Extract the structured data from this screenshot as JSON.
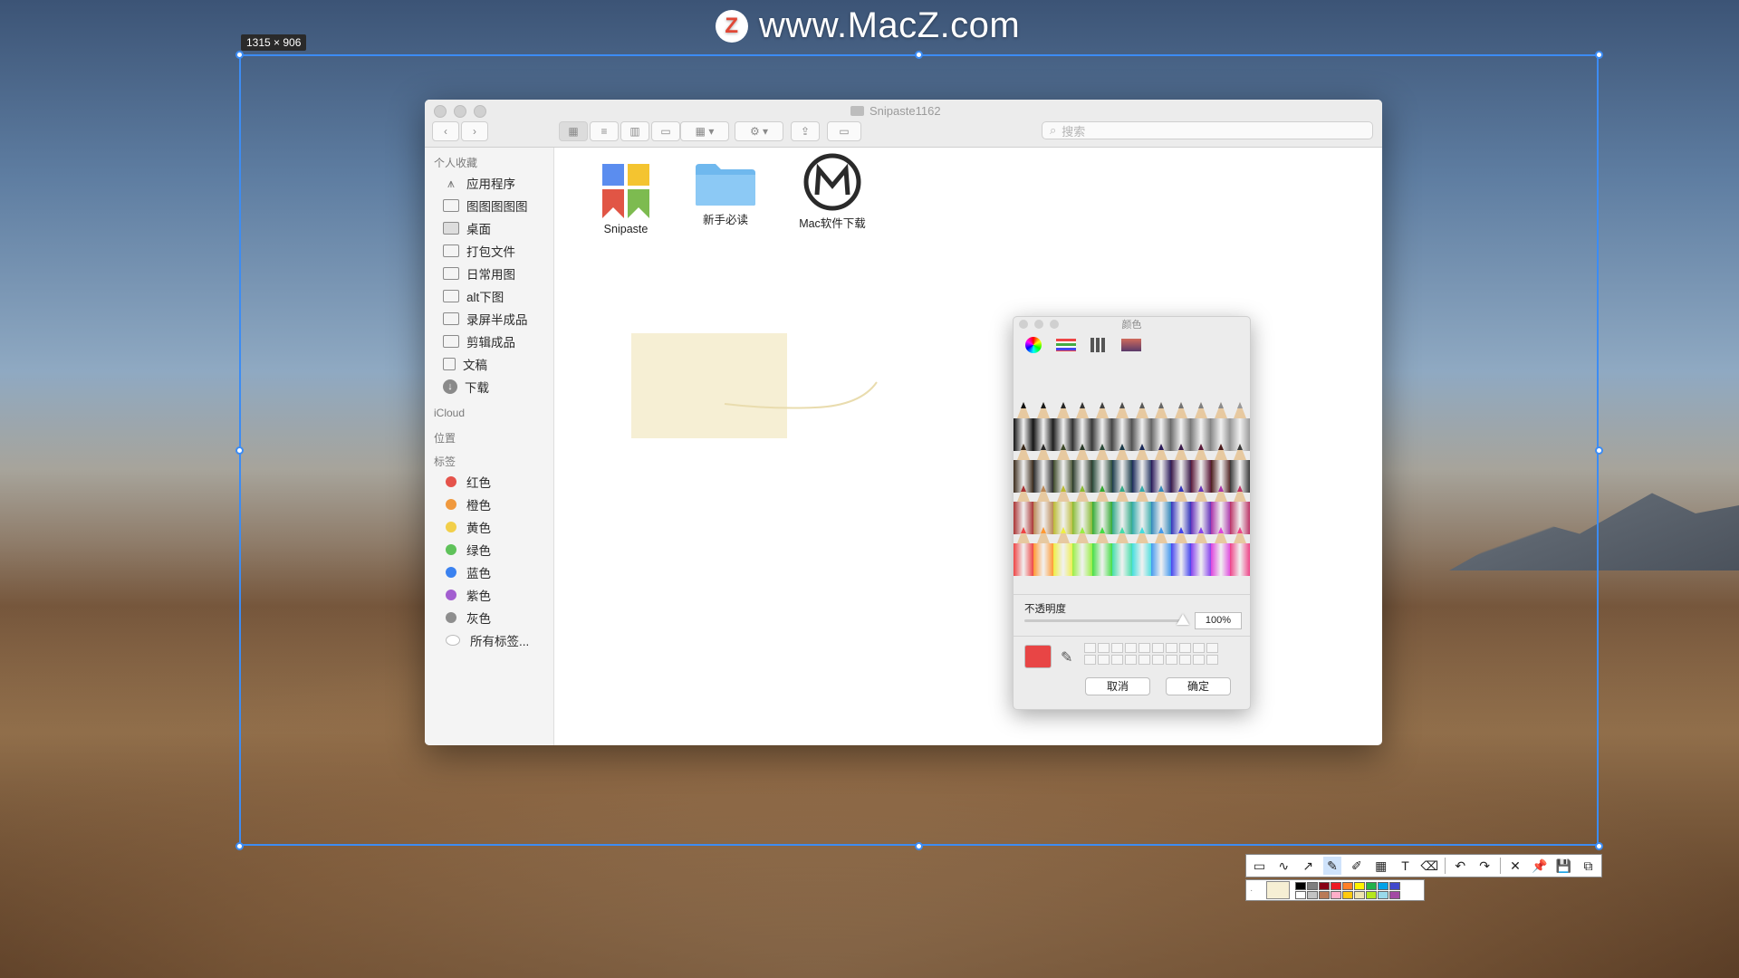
{
  "watermark": {
    "logo_letter": "Z",
    "text": "www.MacZ.com"
  },
  "selection": {
    "size_label": "1315 × 906"
  },
  "finder": {
    "title": "Snipaste1162",
    "search_placeholder": "搜索",
    "sidebar": {
      "favorites_header": "个人收藏",
      "favorites": [
        {
          "label": "应用程序",
          "icon": "apps-icon"
        },
        {
          "label": "图图图图图",
          "icon": "folder-icon"
        },
        {
          "label": "桌面",
          "icon": "desktop-icon"
        },
        {
          "label": "打包文件",
          "icon": "folder-icon"
        },
        {
          "label": "日常用图",
          "icon": "folder-icon"
        },
        {
          "label": "alt下图",
          "icon": "folder-icon"
        },
        {
          "label": "录屏半成品",
          "icon": "folder-icon"
        },
        {
          "label": "剪辑成品",
          "icon": "folder-icon"
        },
        {
          "label": "文稿",
          "icon": "document-icon"
        },
        {
          "label": "下载",
          "icon": "download-icon"
        }
      ],
      "icloud_header": "iCloud",
      "locations_header": "位置",
      "tags_header": "标签",
      "tags": [
        {
          "label": "红色",
          "color": "#e5534b"
        },
        {
          "label": "橙色",
          "color": "#f0993e"
        },
        {
          "label": "黄色",
          "color": "#f2cf4a"
        },
        {
          "label": "绿色",
          "color": "#5fc25a"
        },
        {
          "label": "蓝色",
          "color": "#3b82f0"
        },
        {
          "label": "紫色",
          "color": "#a35fd0"
        },
        {
          "label": "灰色",
          "color": "#8e8e8e"
        },
        {
          "label": "所有标签...",
          "color": "#d9d9d9"
        }
      ]
    },
    "files": [
      {
        "name": "Snipaste",
        "icon": "snipaste-app-icon"
      },
      {
        "name": "新手必读",
        "icon": "folder-icon"
      },
      {
        "name": "Mac软件下载",
        "icon": "macz-logo-icon"
      }
    ]
  },
  "color_panel": {
    "title": "颜色",
    "tabs": [
      "color-wheel-icon",
      "sliders-icon",
      "palettes-icon",
      "image-palette-icon",
      "pencils-icon"
    ],
    "opacity_label": "不透明度",
    "opacity_value": "100%",
    "opacity_fraction": 1.0,
    "current_color": "#e84545",
    "cancel_label": "取消",
    "ok_label": "确定"
  },
  "snipaste_toolbar": {
    "tools": [
      "rectangle-tool-icon",
      "curve-tool-icon",
      "arrow-tool-icon",
      "pencil-tool-icon",
      "marker-tool-icon",
      "mosaic-tool-icon",
      "text-tool-icon",
      "eraser-tool-icon",
      "undo-icon",
      "redo-icon",
      "close-icon",
      "pin-icon",
      "save-icon",
      "copy-icon"
    ],
    "current_color": "#f6efd4",
    "palette": [
      "#000000",
      "#7f7f7f",
      "#880015",
      "#ed1c24",
      "#ff7f27",
      "#fff200",
      "#22b14c",
      "#00a2e8",
      "#3f48cc",
      "#ffffff",
      "#c3c3c3",
      "#b97a57",
      "#ffaec9",
      "#ffc90e",
      "#efe4b0",
      "#b5e61d",
      "#99d9ea",
      "#a349a4"
    ]
  }
}
